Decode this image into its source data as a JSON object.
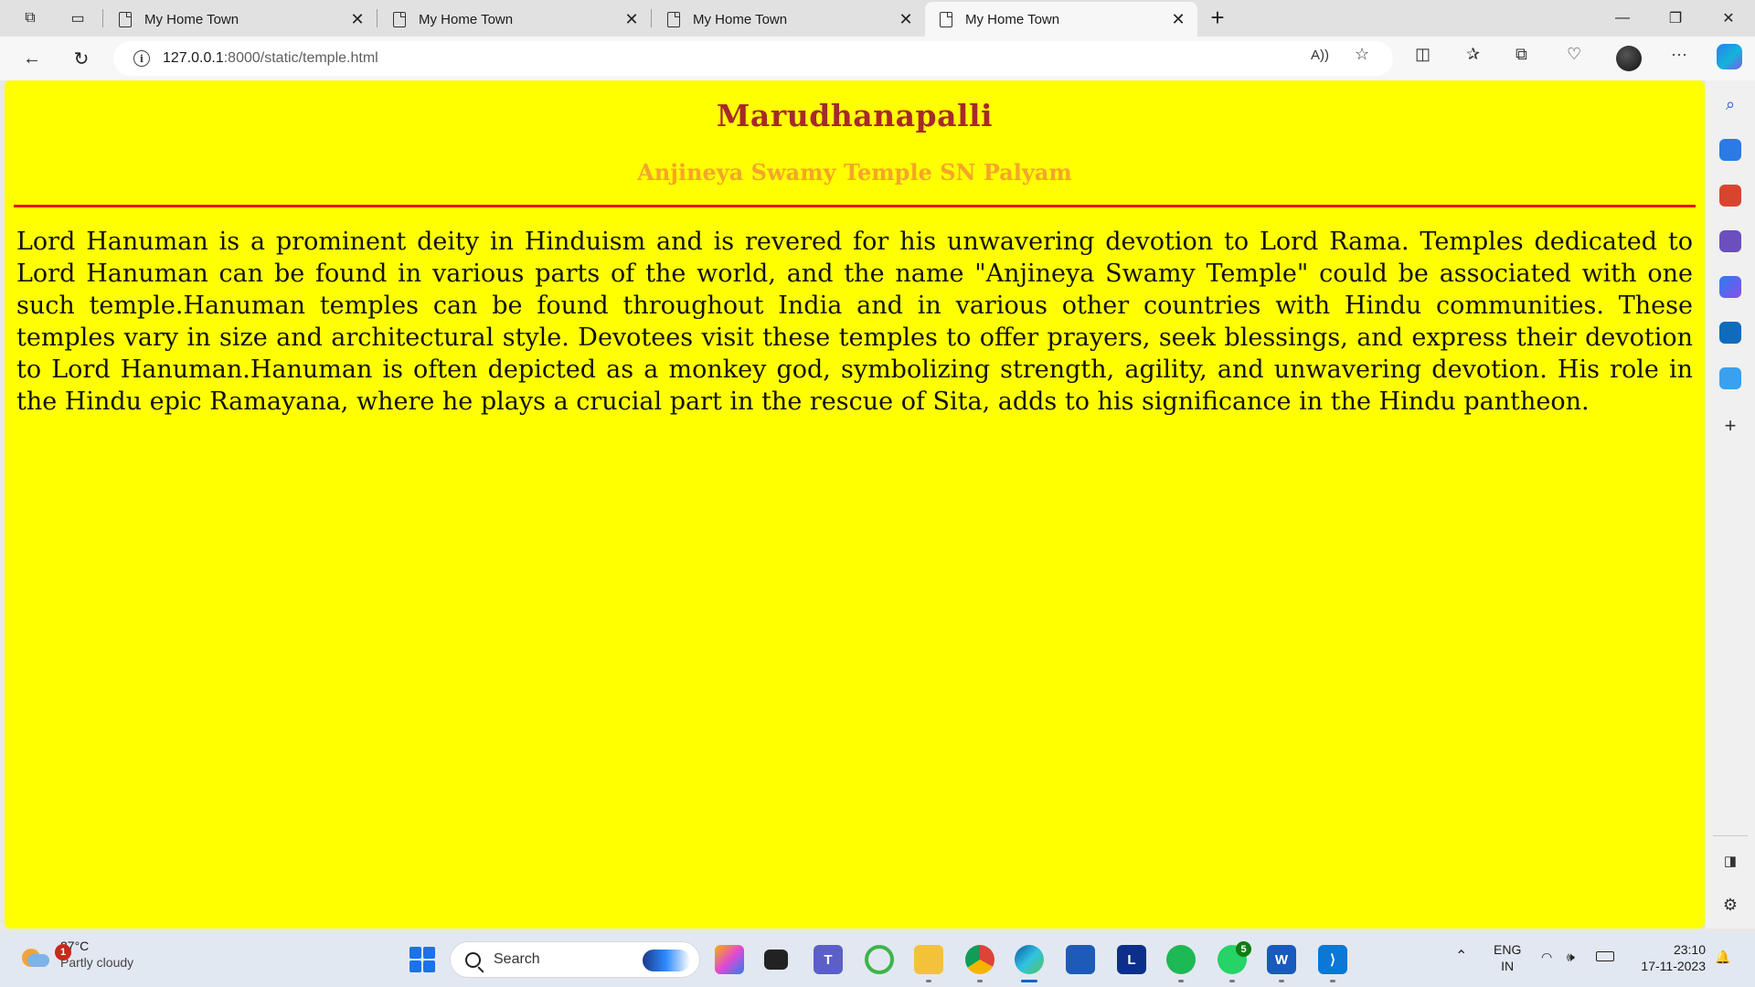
{
  "browser": {
    "tabs": [
      {
        "title": "My Home Town",
        "active": false
      },
      {
        "title": "My Home Town",
        "active": false
      },
      {
        "title": "My Home Town",
        "active": false
      },
      {
        "title": "My Home Town",
        "active": true
      }
    ],
    "address": {
      "host": "127.0.0.1",
      "path": ":8000/static/temple.html"
    }
  },
  "page": {
    "heading": "Marudhanapalli",
    "subheading": "Anjineya Swamy Temple SN Palyam",
    "paragraph": "Lord Hanuman is a prominent deity in Hinduism and is revered for his unwavering devotion to Lord Rama. Temples dedicated to Lord Hanuman can be found in various parts of the world, and the name \"Anjineya Swamy Temple\" could be associated with one such temple.Hanuman temples can be found throughout India and in various other countries with Hindu communities. These temples vary in size and architectural style. Devotees visit these temples to offer prayers, seek blessings, and express their devotion to Lord Hanuman.Hanuman is often depicted as a monkey god, symbolizing strength, agility, and unwavering devotion. His role in the Hindu epic Ramayana, where he plays a crucial part in the rescue of Sita, adds to his significance in the Hindu pantheon.",
    "colors": {
      "background": "#ffff00",
      "heading": "#a52a2a",
      "subheading": "#f4a52a",
      "rule": "#e21818"
    }
  },
  "taskbar": {
    "weather": {
      "temp": "27°C",
      "condition": "Partly cloudy",
      "badge": "1"
    },
    "search_label": "Search",
    "whatsapp_badge": "5",
    "language": {
      "line1": "ENG",
      "line2": "IN"
    },
    "clock": {
      "time": "23:10",
      "date": "17-11-2023"
    }
  }
}
